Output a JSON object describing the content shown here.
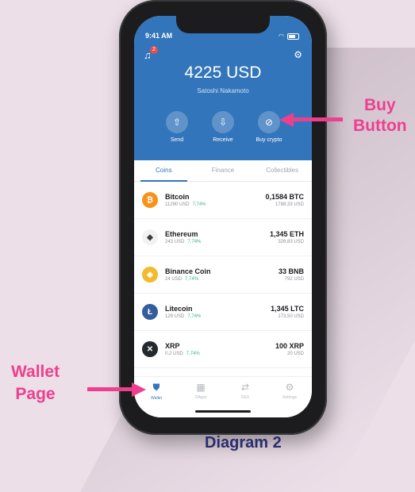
{
  "status": {
    "time": "9:41 AM"
  },
  "header": {
    "badge_count": "2",
    "balance": "4225 USD",
    "username": "Satoshi Nakamoto",
    "actions": [
      {
        "icon": "upload-arrow-icon",
        "label": "Send"
      },
      {
        "icon": "download-arrow-icon",
        "label": "Receive"
      },
      {
        "icon": "tag-icon",
        "label": "Buy crypto"
      }
    ]
  },
  "tabs": [
    "Coins",
    "Finance",
    "Collectibles"
  ],
  "coins": [
    {
      "name": "Bitcoin",
      "price": "11290 USD",
      "change": "7,74%",
      "amount": "0,1584 BTC",
      "value": "1788,33 USD",
      "symbol": "₿",
      "color": "#f7931a"
    },
    {
      "name": "Ethereum",
      "price": "243 USD",
      "change": "7,74%",
      "amount": "1,345 ETH",
      "value": "326,83 USD",
      "symbol": "◆",
      "color": "#f2f2f2"
    },
    {
      "name": "Binance Coin",
      "price": "24 USD",
      "change": "7,74%",
      "amount": "33 BNB",
      "value": "792 USD",
      "symbol": "◈",
      "color": "#f3ba2f"
    },
    {
      "name": "Litecoin",
      "price": "129 USD",
      "change": "7,74%",
      "amount": "1,345 LTC",
      "value": "173,50 USD",
      "symbol": "Ł",
      "color": "#345d9d"
    },
    {
      "name": "XRP",
      "price": "0,2 USD",
      "change": "7,74%",
      "amount": "100 XRP",
      "value": "20 USD",
      "symbol": "✕",
      "color": "#23292f"
    }
  ],
  "nav": [
    {
      "icon": "shield-icon",
      "label": "Wallet",
      "active": true
    },
    {
      "icon": "grid-icon",
      "label": "DApps"
    },
    {
      "icon": "swap-icon",
      "label": "DEX"
    },
    {
      "icon": "gear-icon",
      "label": "Settings"
    }
  ],
  "annotations": {
    "buy_line1": "Buy",
    "buy_line2": "Button",
    "wallet_line1": "Wallet",
    "wallet_line2": "Page",
    "caption": "Diagram 2"
  },
  "colors": {
    "brand_blue": "#3375bb",
    "accent_pink": "#ee3f8f",
    "caption_navy": "#2b2c6e",
    "positive_green": "#3eb286"
  }
}
